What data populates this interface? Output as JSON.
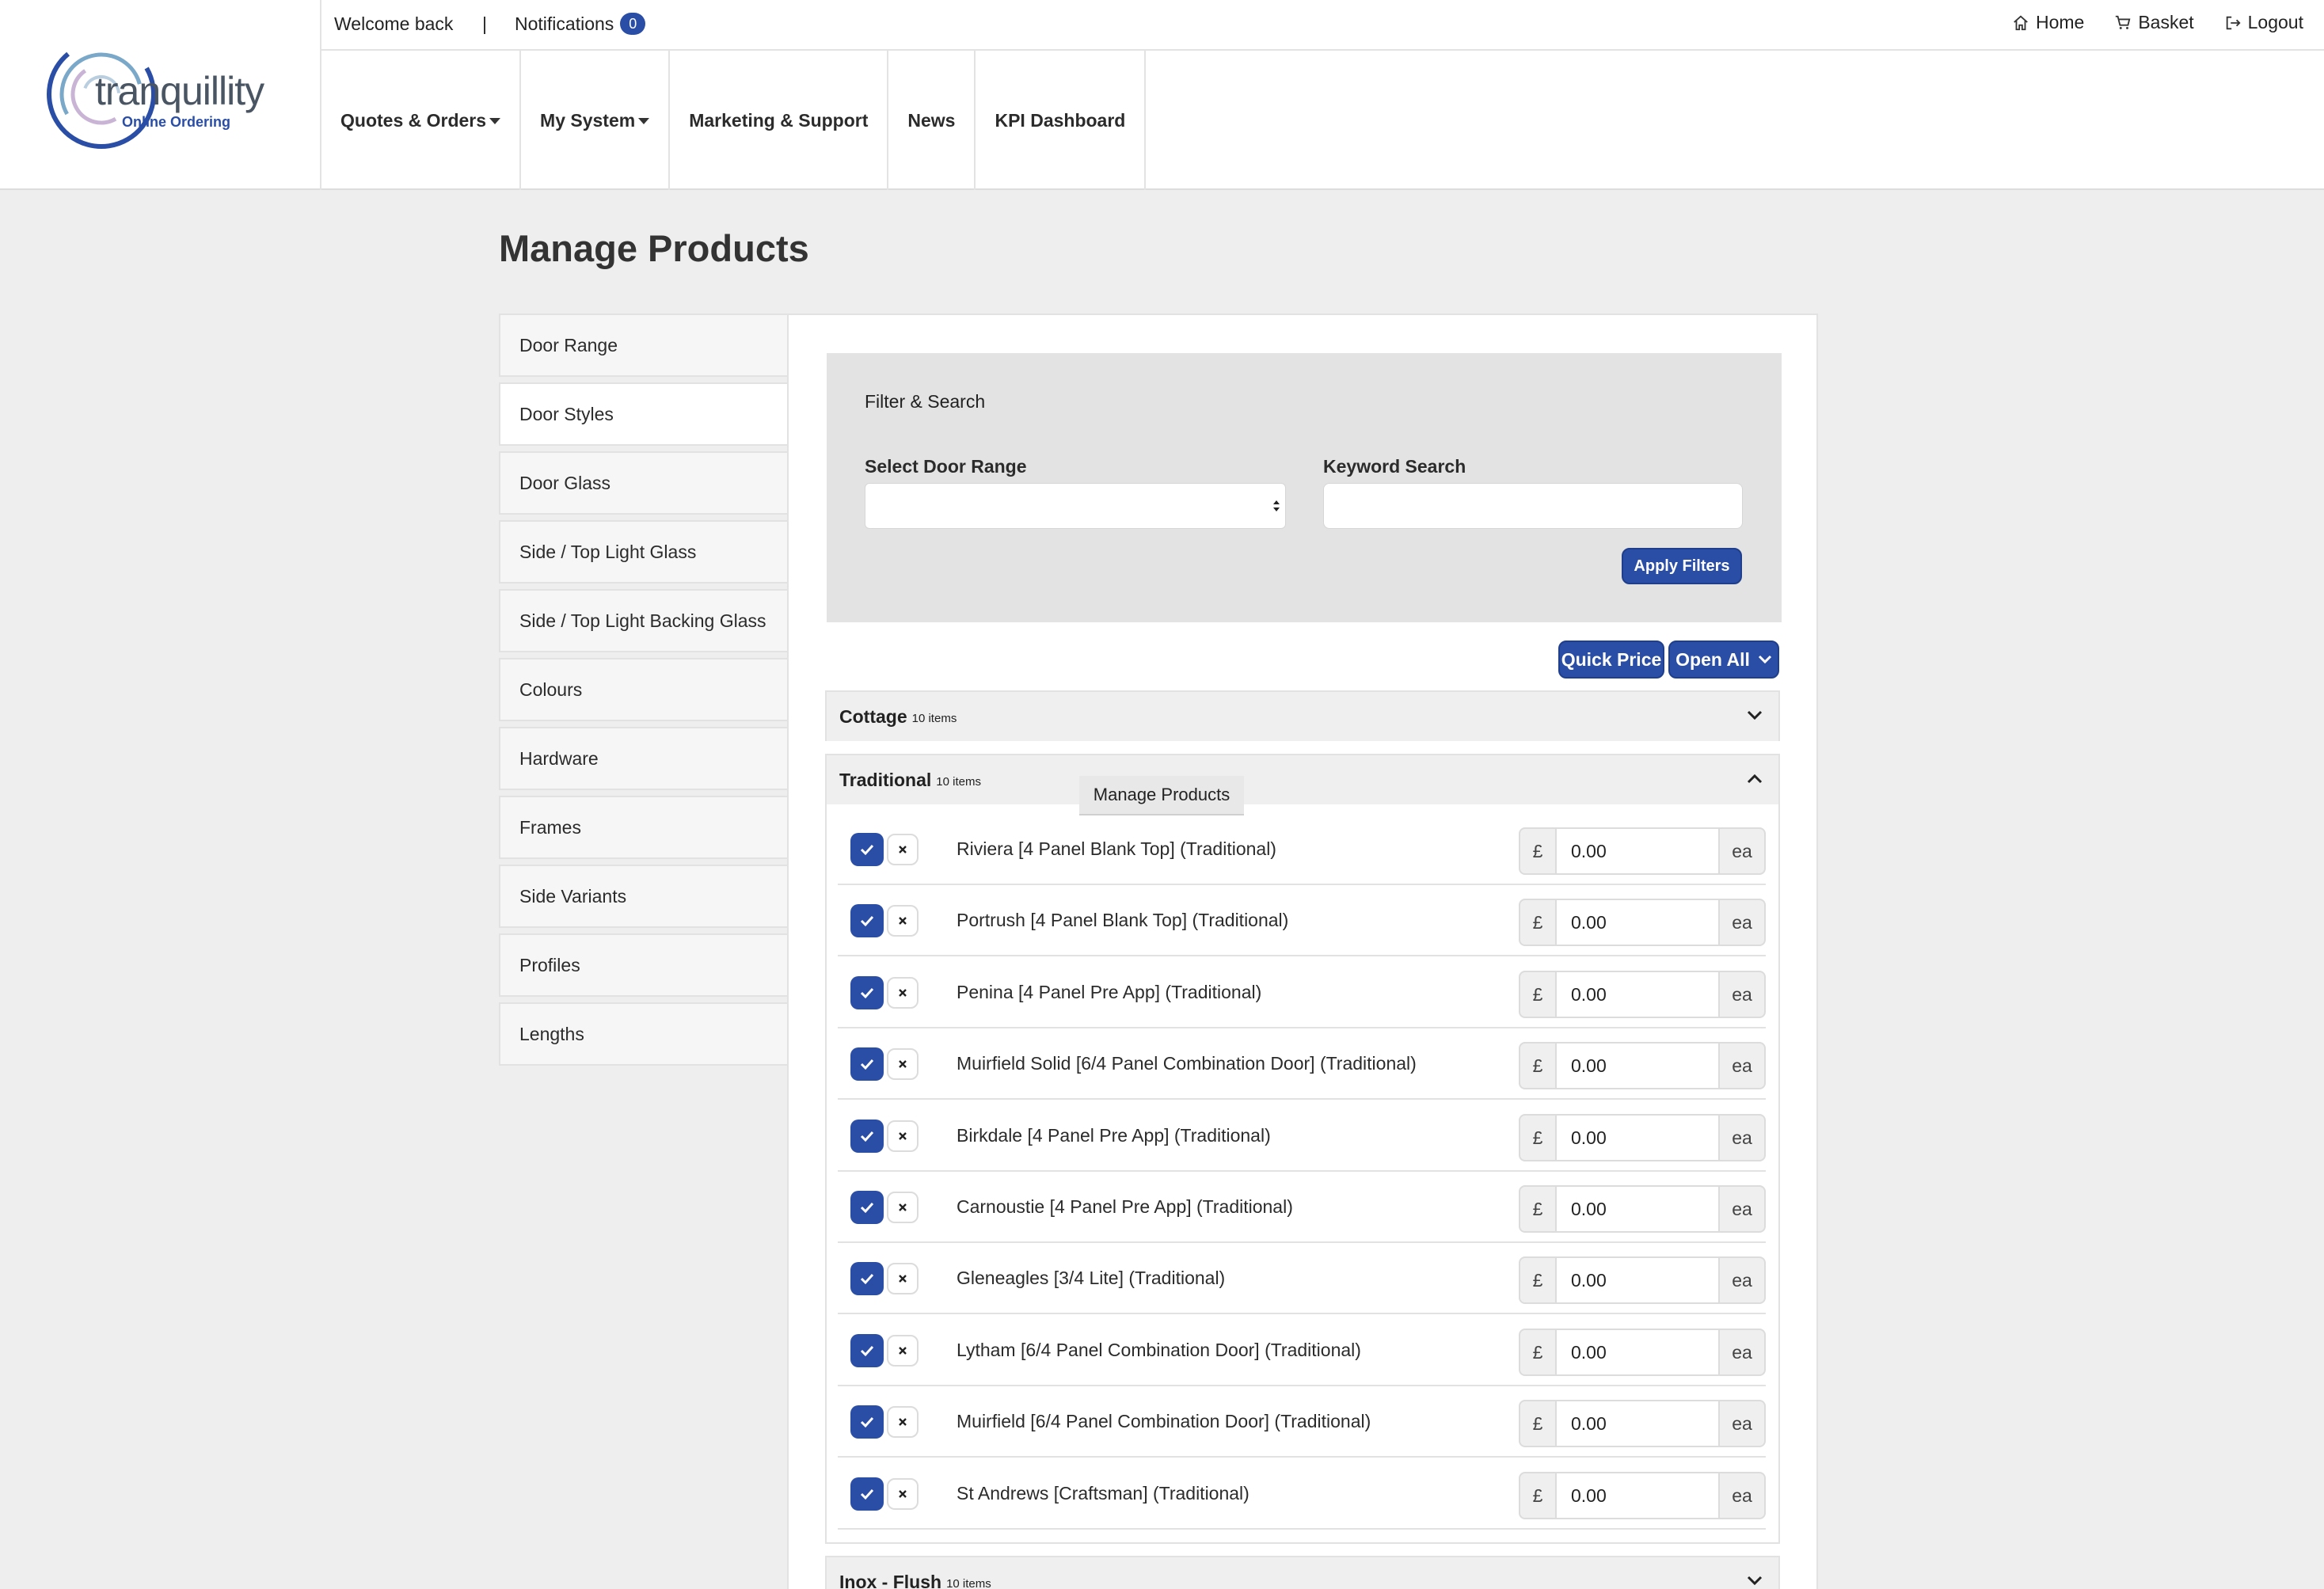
{
  "header": {
    "logo_name": "tranquillity",
    "logo_sub": "Online Ordering",
    "welcome": "Welcome back",
    "separator": "|",
    "notifications_label": "Notifications",
    "notifications_count": "0",
    "home": "Home",
    "basket": "Basket",
    "logout": "Logout"
  },
  "nav": {
    "quotes": "Quotes & Orders",
    "system": "My System",
    "marketing": "Marketing & Support",
    "news": "News",
    "kpi": "KPI Dashboard"
  },
  "page_title": "Manage Products",
  "sidebar": {
    "items": [
      {
        "label": "Door Range"
      },
      {
        "label": "Door Styles"
      },
      {
        "label": "Door Glass"
      },
      {
        "label": "Side / Top Light Glass"
      },
      {
        "label": "Side / Top Light Backing Glass"
      },
      {
        "label": "Colours"
      },
      {
        "label": "Hardware"
      },
      {
        "label": "Frames"
      },
      {
        "label": "Side Variants"
      },
      {
        "label": "Profiles"
      },
      {
        "label": "Lengths"
      }
    ]
  },
  "filter": {
    "title": "Filter & Search",
    "range_label": "Select Door Range",
    "range_value": "",
    "keyword_label": "Keyword Search",
    "keyword_value": "",
    "apply": "Apply Filters"
  },
  "actions": {
    "quick_price": "Quick Price",
    "open_all": "Open All"
  },
  "tooltip": "Manage Products",
  "groups": [
    {
      "name": "Cottage",
      "count": "10 items"
    },
    {
      "name": "Traditional",
      "count": "10 items"
    },
    {
      "name": "Inox - Flush",
      "count": "10 items"
    }
  ],
  "currency": "£",
  "unit": "ea",
  "products": [
    {
      "name": "Riviera [4 Panel Blank Top] (Traditional)",
      "price": "0.00"
    },
    {
      "name": "Portrush [4 Panel Blank Top] (Traditional)",
      "price": "0.00"
    },
    {
      "name": "Penina [4 Panel Pre App] (Traditional)",
      "price": "0.00"
    },
    {
      "name": "Muirfield Solid [6/4 Panel Combination Door] (Traditional)",
      "price": "0.00"
    },
    {
      "name": "Birkdale [4 Panel Pre App] (Traditional)",
      "price": "0.00"
    },
    {
      "name": "Carnoustie [4 Panel Pre App] (Traditional)",
      "price": "0.00"
    },
    {
      "name": "Gleneagles [3/4 Lite] (Traditional)",
      "price": "0.00"
    },
    {
      "name": "Lytham [6/4 Panel Combination Door] (Traditional)",
      "price": "0.00"
    },
    {
      "name": "Muirfield [6/4 Panel Combination Door] (Traditional)",
      "price": "0.00"
    },
    {
      "name": "St Andrews [Craftsman] (Traditional)",
      "price": "0.00"
    }
  ],
  "colors": {
    "accent": "#2a4ea6",
    "page_bg": "#eeeeee",
    "filter_bg": "#e3e3e3"
  },
  "icons": [
    "home-icon",
    "cart-icon",
    "logout-icon",
    "check-icon",
    "close-icon",
    "chevron-down-icon",
    "chevron-up-icon",
    "sort-arrows-icon"
  ]
}
